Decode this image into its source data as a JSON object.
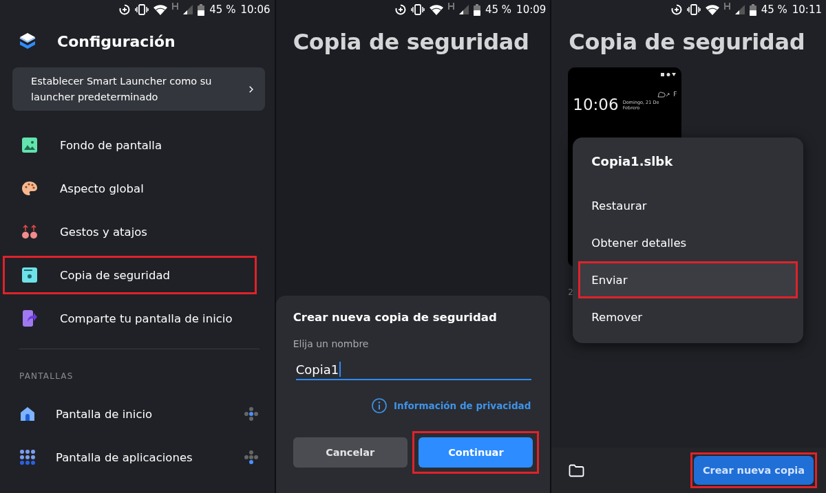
{
  "panels": [
    {
      "kind": "settings",
      "status_bar": {
        "battery": "45 %",
        "time": "10:06"
      },
      "title": "Configuración",
      "banner": "Establecer Smart Launcher como su launcher predeterminado",
      "items": [
        {
          "label": "Fondo de pantalla",
          "highlighted": false
        },
        {
          "label": "Aspecto global",
          "highlighted": false
        },
        {
          "label": "Gestos y atajos",
          "highlighted": false
        },
        {
          "label": "Copia de seguridad",
          "highlighted": true
        },
        {
          "label": "Comparte tu pantalla de inicio",
          "highlighted": false
        }
      ],
      "section": "PANTALLAS",
      "screen_items": [
        {
          "label": "Pantalla de inicio"
        },
        {
          "label": "Pantalla de aplicaciones"
        }
      ]
    },
    {
      "kind": "create_dialog",
      "status_bar": {
        "battery": "45 %",
        "time": "10:09"
      },
      "title": "Copia de seguridad",
      "dialog": {
        "title": "Crear nueva copia de seguridad",
        "label": "Elija un nombre",
        "value": "Copia1",
        "privacy_link": "Información de privacidad",
        "buttons": [
          {
            "label": "Cancelar",
            "kind": "secondary",
            "highlighted": false
          },
          {
            "label": "Continuar",
            "kind": "primary",
            "highlighted": true
          }
        ]
      }
    },
    {
      "kind": "backup_menu",
      "status_bar": {
        "battery": "45 %",
        "time": "10:11"
      },
      "title": "Copia de seguridad",
      "backup": {
        "preview_time": "10:06",
        "preview_weather": "F",
        "preview_date": "Domingo, 21 De Febrero",
        "date": "2"
      },
      "menu": {
        "title": "Copia1.slbk",
        "items": [
          {
            "label": "Restaurar",
            "highlighted": false
          },
          {
            "label": "Obtener detalles",
            "highlighted": false
          },
          {
            "label": "Enviar",
            "highlighted": true
          },
          {
            "label": "Remover",
            "highlighted": false
          }
        ]
      },
      "create_button": {
        "label": "Crear nueva copia",
        "highlighted": true
      }
    }
  ]
}
